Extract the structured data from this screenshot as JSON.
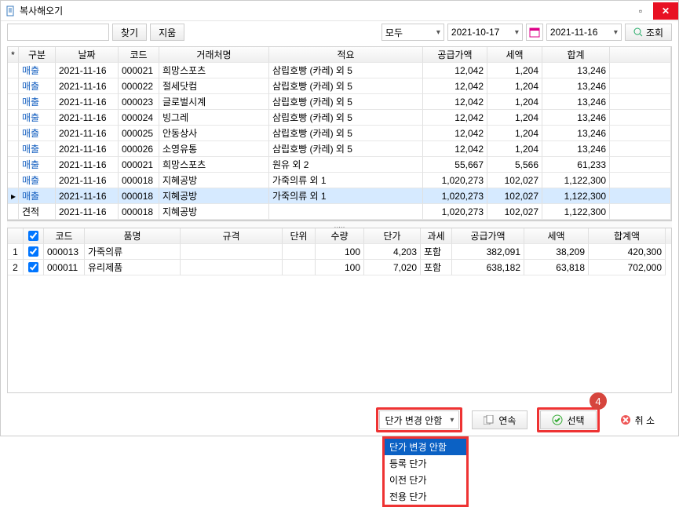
{
  "window": {
    "title": "복사해오기"
  },
  "toolbar": {
    "find_label": "찾기",
    "clear_label": "지움",
    "filter_value": "모두",
    "date_from": "2021-10-17",
    "date_to": "2021-11-16",
    "query_label": "조회"
  },
  "grid1": {
    "headers": {
      "star": "*",
      "gubun": "구분",
      "date": "날짜",
      "code": "코드",
      "vendor": "거래처명",
      "desc": "적요",
      "supply": "공급가액",
      "tax": "세액",
      "total": "합계"
    },
    "rows": [
      {
        "g": "매출",
        "d": "2021-11-16",
        "c": "000021",
        "v": "희망스포츠",
        "s": "삼립호빵 (카레) 외 5",
        "sup": "12,042",
        "tax": "1,204",
        "tot": "13,246"
      },
      {
        "g": "매출",
        "d": "2021-11-16",
        "c": "000022",
        "v": "절세닷컴",
        "s": "삼립호빵 (카레) 외 5",
        "sup": "12,042",
        "tax": "1,204",
        "tot": "13,246"
      },
      {
        "g": "매출",
        "d": "2021-11-16",
        "c": "000023",
        "v": "글로벌시계",
        "s": "삼립호빵 (카레) 외 5",
        "sup": "12,042",
        "tax": "1,204",
        "tot": "13,246"
      },
      {
        "g": "매출",
        "d": "2021-11-16",
        "c": "000024",
        "v": "빙그레",
        "s": "삼립호빵 (카레) 외 5",
        "sup": "12,042",
        "tax": "1,204",
        "tot": "13,246"
      },
      {
        "g": "매출",
        "d": "2021-11-16",
        "c": "000025",
        "v": "안동상사",
        "s": "삼립호빵 (카레) 외 5",
        "sup": "12,042",
        "tax": "1,204",
        "tot": "13,246"
      },
      {
        "g": "매출",
        "d": "2021-11-16",
        "c": "000026",
        "v": "소영유통",
        "s": "삼립호빵 (카레) 외 5",
        "sup": "12,042",
        "tax": "1,204",
        "tot": "13,246"
      },
      {
        "g": "매출",
        "d": "2021-11-16",
        "c": "000021",
        "v": "희망스포츠",
        "s": "원유 외 2",
        "sup": "55,667",
        "tax": "5,566",
        "tot": "61,233"
      },
      {
        "g": "매출",
        "d": "2021-11-16",
        "c": "000018",
        "v": "지혜공방",
        "s": "가죽의류 외 1",
        "sup": "1,020,273",
        "tax": "102,027",
        "tot": "1,122,300"
      },
      {
        "g": "매출",
        "d": "2021-11-16",
        "c": "000018",
        "v": "지혜공방",
        "s": "가죽의류 외 1",
        "sup": "1,020,273",
        "tax": "102,027",
        "tot": "1,122,300",
        "sel": true,
        "mark": "▸"
      },
      {
        "g": "견적",
        "d": "2021-11-16",
        "c": "000018",
        "v": "지혜공방",
        "s": "",
        "sup": "1,020,273",
        "tax": "102,027",
        "tot": "1,122,300"
      }
    ]
  },
  "separator": ".....",
  "grid2": {
    "headers": {
      "n": "",
      "ck": "☑",
      "code": "코드",
      "name": "품명",
      "spec": "규격",
      "unit": "단위",
      "qty": "수량",
      "price": "단가",
      "tax": "과세",
      "supply": "공급가액",
      "taxamt": "세액",
      "total": "합계액"
    },
    "rows": [
      {
        "n": "1",
        "ck": true,
        "code": "000013",
        "name": "가죽의류",
        "spec": "",
        "unit": "",
        "qty": "100",
        "price": "4,203",
        "tax": "포함",
        "supply": "382,091",
        "taxamt": "38,209",
        "total": "420,300"
      },
      {
        "n": "2",
        "ck": true,
        "code": "000011",
        "name": "유리제품",
        "spec": "",
        "unit": "",
        "qty": "100",
        "price": "7,020",
        "tax": "포함",
        "supply": "638,182",
        "taxamt": "63,818",
        "total": "702,000"
      }
    ]
  },
  "footer": {
    "price_change_value": "단가 변경 안함",
    "cont_label": "연속",
    "select_label": "선택",
    "cancel_label": "취 소"
  },
  "dropdown": {
    "items": [
      "단가 변경 안함",
      "등록 단가",
      "이전 단가",
      "전용 단가"
    ]
  },
  "badge": "4"
}
